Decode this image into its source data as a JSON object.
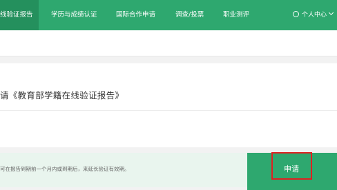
{
  "nav": {
    "items": [
      {
        "label": "线验证报告",
        "active": true
      },
      {
        "label": "学历与成绩认证",
        "active": false
      },
      {
        "label": "国际合作申请",
        "active": false
      },
      {
        "label": "调查/投票",
        "active": false
      },
      {
        "label": "职业测评",
        "active": false
      }
    ],
    "user_menu": "个人中心",
    "icons": [
      "user-icon",
      "chevron-down-icon"
    ]
  },
  "main": {
    "title": "请《教育部学籍在线验证报告》"
  },
  "notice": {
    "text": "可在报告到期前一个月内或到期后，来延长验证有效期。"
  },
  "apply_button": {
    "label": "申请"
  },
  "colors": {
    "brand_green": "#2ea86f",
    "active_green": "#24905d",
    "notice_bg": "#e9f5ee",
    "highlight_red": "#e02020"
  }
}
